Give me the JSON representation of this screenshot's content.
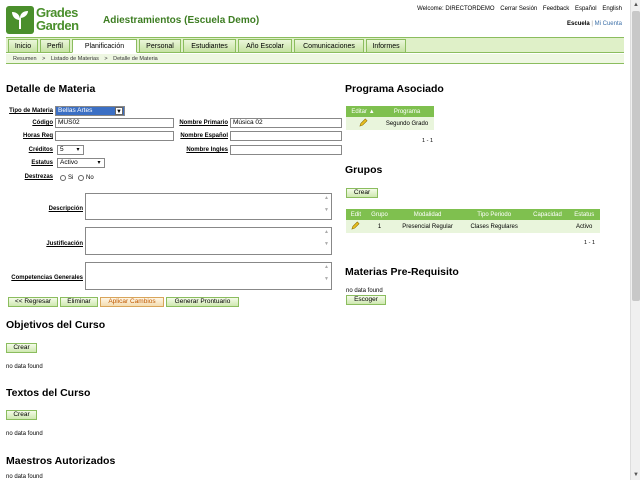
{
  "header": {
    "logo_line1": "Grades",
    "logo_line2": "Garden",
    "app_title": "Adiestramientos (Escuela Demo)",
    "welcome": "Welcome: DIRECTORDEMO",
    "logout": "Cerrar Sesión",
    "feedback": "Feedback",
    "lang_es": "Español",
    "lang_en": "English",
    "school": "Escuela",
    "separator": "|",
    "account": "Mi Cuenta"
  },
  "nav": {
    "tabs": [
      {
        "label": "Inicio"
      },
      {
        "label": "Perfil"
      },
      {
        "label": "Planificación"
      },
      {
        "label": "Personal"
      },
      {
        "label": "Estudiantes"
      },
      {
        "label": "Año Escolar"
      },
      {
        "label": "Comunicaciones"
      },
      {
        "label": "Informes"
      }
    ]
  },
  "breadcrumb": [
    "Resumen",
    ">",
    "Listado de Materias",
    ">",
    "Detalle de Materia"
  ],
  "detalle": {
    "title": "Detalle de Materia",
    "tipo_label": "Tipo de Materia",
    "tipo_value": "Bellas Artes",
    "codigo_label": "Código",
    "codigo_value": "MUS02",
    "nombre_primario_label": "Nombre Primario",
    "nombre_primario_value": "Música 02",
    "horas_label": "Horas Req",
    "horas_value": "",
    "nombre_espanol_label": "Nombre Español",
    "nombre_espanol_value": "",
    "creditos_label": "Créditos",
    "creditos_value": "5",
    "nombre_ingles_label": "Nombre Ingles",
    "nombre_ingles_value": "",
    "estatus_label": "Estatus",
    "estatus_value": "Activo",
    "destrezas_label": "Destrezas",
    "si_label": "Si",
    "no_label": "No",
    "descripcion_label": "Descripción",
    "justificacion_label": "Justificación",
    "competencias_label": "Competencias Generales",
    "buttons": {
      "regresar": "<< Regresar",
      "eliminar": "Eliminar",
      "aplicar": "Aplicar Cambios",
      "prontuario": "Generar Prontuario"
    }
  },
  "objetivos": {
    "title": "Objetivos del Curso",
    "crear": "Crear",
    "empty": "no data found"
  },
  "textos": {
    "title": "Textos del Curso",
    "crear": "Crear",
    "empty": "no data found"
  },
  "maestros": {
    "title": "Maestros Autorizados",
    "empty": "no data found"
  },
  "programa": {
    "title": "Programa Asociado",
    "col_editar": "Editar",
    "col_programa": "Programa",
    "rows": [
      {
        "programa": "Segundo Grado"
      }
    ],
    "pager": "1 - 1"
  },
  "grupos": {
    "title": "Grupos",
    "crear": "Crear",
    "columns": [
      "Edit",
      "Grupo",
      "Modalidad",
      "Tipo Periodo",
      "Capacidad",
      "Estatus"
    ],
    "rows": [
      {
        "grupo": "1",
        "modalidad": "Presencial Regular",
        "tipo": "Clases Regulares",
        "capacidad": "",
        "estatus": "Activo"
      }
    ],
    "pager": "1 - 1"
  },
  "prereq": {
    "title": "Materias Pre-Requisito",
    "empty": "no data found",
    "escoger": "Escoger"
  },
  "colors": {
    "brand_green": "#4a8f2c",
    "tab_green": "#c6e3a4",
    "table_header": "#7fc04f",
    "warn": "#c05a00"
  }
}
